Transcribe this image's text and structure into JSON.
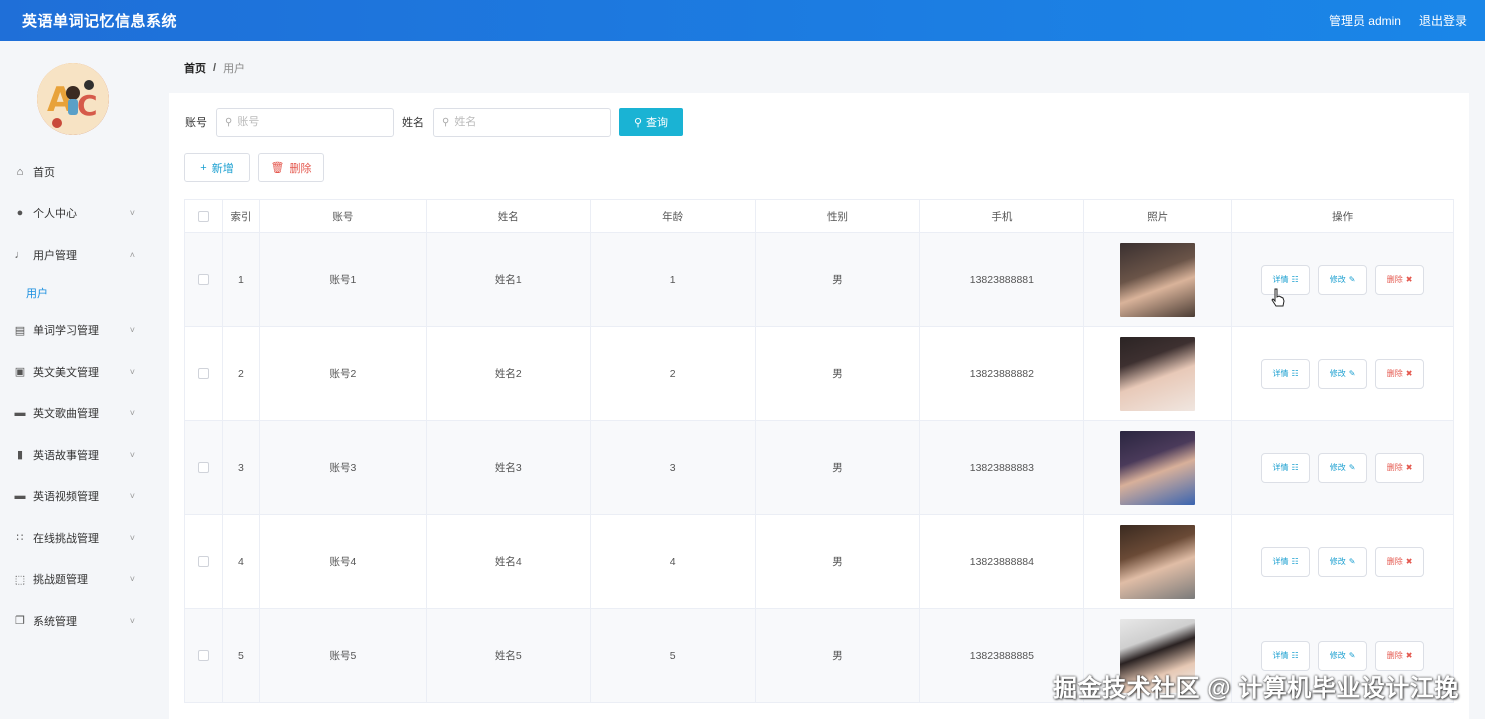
{
  "header": {
    "app_title": "英语单词记忆信息系统",
    "user_label": "管理员 admin",
    "logout_label": "退出登录"
  },
  "sidebar": {
    "items": [
      {
        "label": "首页",
        "icon": "home-icon",
        "expandable": false
      },
      {
        "label": "个人中心",
        "icon": "user-icon",
        "expandable": true
      },
      {
        "label": "用户管理",
        "icon": "mic-icon",
        "expandable": true,
        "expanded": true
      },
      {
        "label": "单词学习管理",
        "icon": "briefcase-icon",
        "expandable": true
      },
      {
        "label": "英文美文管理",
        "icon": "clipboard-icon",
        "expandable": true
      },
      {
        "label": "英文歌曲管理",
        "icon": "comment-icon",
        "expandable": true
      },
      {
        "label": "英语故事管理",
        "icon": "microphone-icon",
        "expandable": true
      },
      {
        "label": "英语视频管理",
        "icon": "message-icon",
        "expandable": true
      },
      {
        "label": "在线挑战管理",
        "icon": "grid-icon",
        "expandable": true
      },
      {
        "label": "挑战题管理",
        "icon": "fullscreen-icon",
        "expandable": true
      },
      {
        "label": "系统管理",
        "icon": "copy-icon",
        "expandable": true
      }
    ],
    "submenu": {
      "label": "用户"
    }
  },
  "breadcrumb": {
    "home": "首页",
    "separator": "/",
    "current": "用户"
  },
  "search": {
    "account_label": "账号",
    "account_placeholder": "账号",
    "name_label": "姓名",
    "name_placeholder": "姓名",
    "query_label": "查询"
  },
  "actions": {
    "add_label": "新增",
    "delete_label": "删除"
  },
  "table": {
    "columns": [
      "索引",
      "账号",
      "姓名",
      "年龄",
      "性别",
      "手机",
      "照片",
      "操作"
    ],
    "rows": [
      {
        "index": "1",
        "account": "账号1",
        "name": "姓名1",
        "age": "1",
        "gender": "男",
        "phone": "13823888881"
      },
      {
        "index": "2",
        "account": "账号2",
        "name": "姓名2",
        "age": "2",
        "gender": "男",
        "phone": "13823888882"
      },
      {
        "index": "3",
        "account": "账号3",
        "name": "姓名3",
        "age": "3",
        "gender": "男",
        "phone": "13823888883"
      },
      {
        "index": "4",
        "account": "账号4",
        "name": "姓名4",
        "age": "4",
        "gender": "男",
        "phone": "13823888884"
      },
      {
        "index": "5",
        "account": "账号5",
        "name": "姓名5",
        "age": "5",
        "gender": "男",
        "phone": "13823888885"
      }
    ],
    "op_labels": {
      "detail": "详情",
      "edit": "修改",
      "remove": "删除"
    }
  },
  "watermark": "掘金技术社区 @ 计算机毕业设计江挽",
  "colors": {
    "topbar": "#1f6fd8",
    "accent": "#1ab3d4",
    "danger": "#e4574d",
    "link": "#1a8fe0"
  }
}
